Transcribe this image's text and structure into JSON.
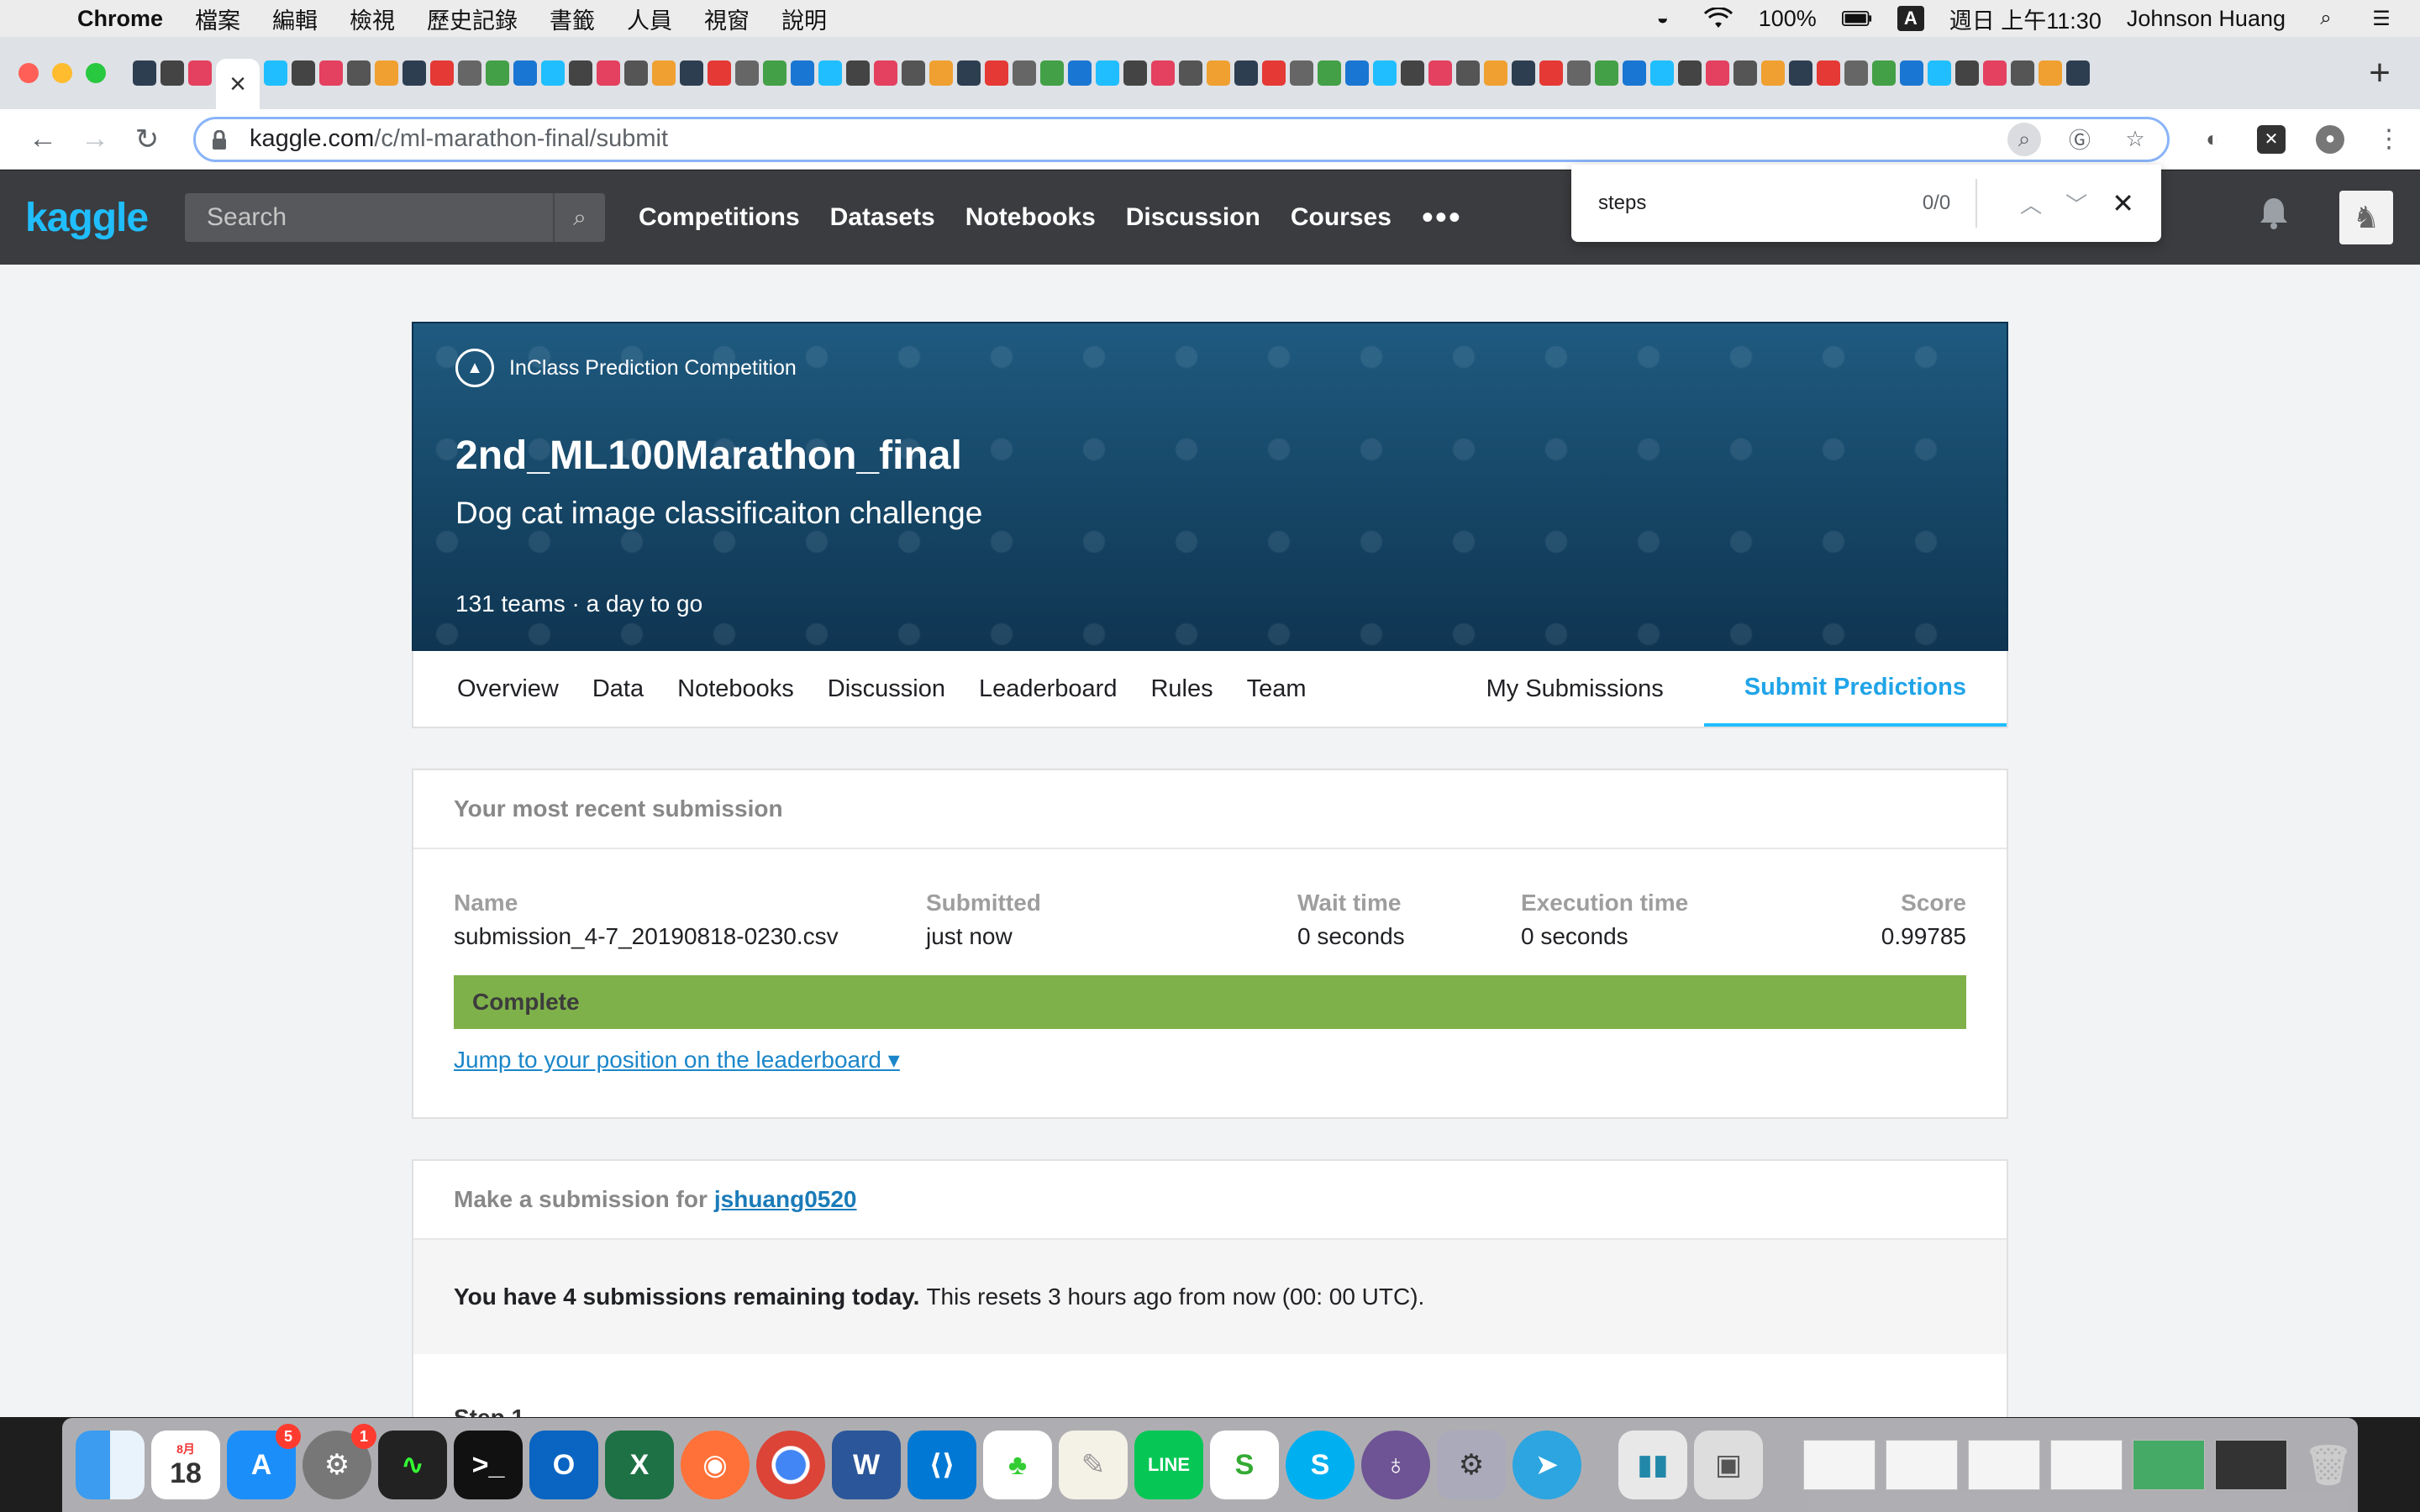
{
  "menubar": {
    "app_name": "Chrome",
    "menus": [
      "檔案",
      "編輯",
      "檢視",
      "歷史記錄",
      "書籤",
      "人員",
      "視窗",
      "說明"
    ],
    "battery": "100%",
    "input_method": "A",
    "datetime": "週日 上午11:30",
    "user": "Johnson Huang"
  },
  "browser": {
    "url_host": "kaggle.com",
    "url_path": "/c/ml-marathon-final/submit",
    "find": {
      "query": "steps",
      "count": "0/0"
    }
  },
  "kaggle_header": {
    "logo": "kaggle",
    "search_placeholder": "Search",
    "nav": [
      "Competitions",
      "Datasets",
      "Notebooks",
      "Discussion",
      "Courses"
    ],
    "more": "•••"
  },
  "competition": {
    "type": "InClass Prediction Competition",
    "title": "2nd_ML100Marathon_final",
    "subtitle": "Dog cat image classificaiton challenge",
    "meta": "131 teams  ·  a day to go",
    "tabs": [
      "Overview",
      "Data",
      "Notebooks",
      "Discussion",
      "Leaderboard",
      "Rules",
      "Team"
    ],
    "right_tabs": [
      "My Submissions",
      "Submit Predictions"
    ],
    "active_tab": "Submit Predictions"
  },
  "recent_submission": {
    "heading": "Your most recent submission",
    "columns": {
      "name": {
        "label": "Name",
        "value": "submission_4-7_20190818-0230.csv"
      },
      "submitted": {
        "label": "Submitted",
        "value": "just now"
      },
      "wait": {
        "label": "Wait time",
        "value": "0 seconds"
      },
      "exec": {
        "label": "Execution time",
        "value": "0 seconds"
      },
      "score": {
        "label": "Score",
        "value": "0.99785"
      }
    },
    "status": "Complete",
    "jump_link": "Jump to your position on the leaderboard ▾"
  },
  "make_submission": {
    "heading": "Make a submission for",
    "username": "jshuang0520",
    "remaining_bold": "You have 4 submissions remaining today.",
    "remaining_rest": "This resets 3 hours ago from now (00: 00 UTC).",
    "step": "Step 1"
  },
  "dock": {
    "calendar_day": "18",
    "calendar_month": "8月",
    "appstore_badge": "5",
    "prefs_badge": "1"
  },
  "colors": {
    "kaggle_blue": "#20beff",
    "header_bg": "#3b3c3f",
    "complete_green": "#7fb14a",
    "link_blue": "#1b86c9"
  }
}
